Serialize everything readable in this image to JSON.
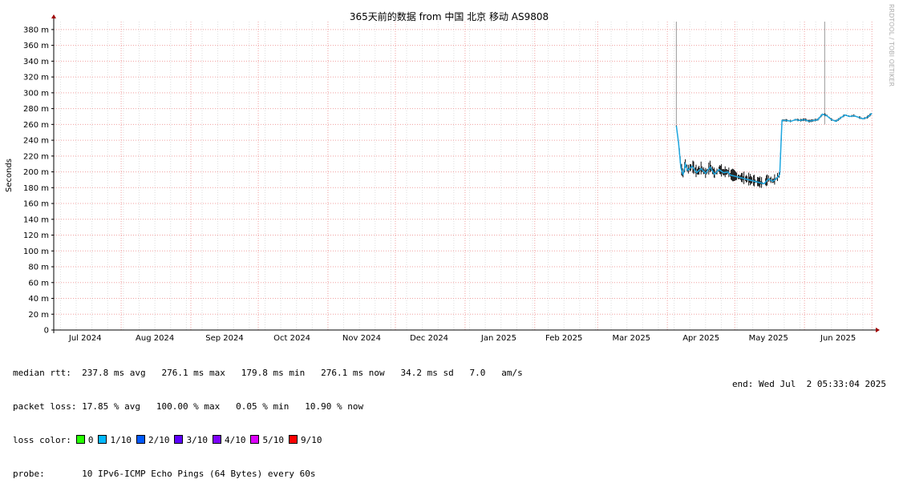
{
  "chart_data": {
    "type": "line",
    "title": "365天前的数据 from 中国 北京 移动 AS9808",
    "ylabel": "Seconds",
    "xlabel": "",
    "ylim": [
      0,
      390
    ],
    "yticks": [
      {
        "v": 0,
        "label": "0"
      },
      {
        "v": 20,
        "label": "20 m"
      },
      {
        "v": 40,
        "label": "40 m"
      },
      {
        "v": 60,
        "label": "60 m"
      },
      {
        "v": 80,
        "label": "80 m"
      },
      {
        "v": 100,
        "label": "100 m"
      },
      {
        "v": 120,
        "label": "120 m"
      },
      {
        "v": 140,
        "label": "140 m"
      },
      {
        "v": 160,
        "label": "160 m"
      },
      {
        "v": 180,
        "label": "180 m"
      },
      {
        "v": 200,
        "label": "200 m"
      },
      {
        "v": 220,
        "label": "220 m"
      },
      {
        "v": 240,
        "label": "240 m"
      },
      {
        "v": 260,
        "label": "260 m"
      },
      {
        "v": 280,
        "label": "280 m"
      },
      {
        "v": 300,
        "label": "300 m"
      },
      {
        "v": 320,
        "label": "320 m"
      },
      {
        "v": 340,
        "label": "340 m"
      },
      {
        "v": 360,
        "label": "360 m"
      },
      {
        "v": 380,
        "label": "380 m"
      }
    ],
    "x_range": [
      "2024-07-02",
      "2025-07-02"
    ],
    "xticks": [
      {
        "label": "Jul 2024",
        "date": "2024-07-16"
      },
      {
        "label": "Aug 2024",
        "date": "2024-08-16"
      },
      {
        "label": "Sep 2024",
        "date": "2024-09-16"
      },
      {
        "label": "Oct 2024",
        "date": "2024-10-16"
      },
      {
        "label": "Nov 2024",
        "date": "2024-11-16"
      },
      {
        "label": "Dec 2024",
        "date": "2024-12-16"
      },
      {
        "label": "Jan 2025",
        "date": "2025-01-16"
      },
      {
        "label": "Feb 2025",
        "date": "2025-02-14"
      },
      {
        "label": "Mar 2025",
        "date": "2025-03-16"
      },
      {
        "label": "Apr 2025",
        "date": "2025-04-16"
      },
      {
        "label": "May 2025",
        "date": "2025-05-16"
      },
      {
        "label": "Jun 2025",
        "date": "2025-06-16"
      }
    ],
    "month_boundaries": [
      "2024-08-01",
      "2024-09-01",
      "2024-10-01",
      "2024-11-01",
      "2024-12-01",
      "2025-01-01",
      "2025-02-01",
      "2025-03-01",
      "2025-04-01",
      "2025-05-01",
      "2025-06-01",
      "2025-07-01"
    ],
    "grid": true,
    "series": [
      {
        "color": "#1ea7e0",
        "x": [
          "2025-04-05",
          "2025-04-06",
          "2025-04-07",
          "2025-04-08",
          "2025-04-09",
          "2025-04-10",
          "2025-04-12",
          "2025-04-14",
          "2025-04-16",
          "2025-04-18",
          "2025-04-20",
          "2025-04-22",
          "2025-04-24",
          "2025-04-26",
          "2025-04-28",
          "2025-04-29",
          "2025-05-14",
          "2025-05-16",
          "2025-05-18",
          "2025-05-20",
          "2025-05-21",
          "2025-05-22",
          "2025-05-24",
          "2025-05-26",
          "2025-05-28",
          "2025-05-30",
          "2025-06-01",
          "2025-06-03",
          "2025-06-05",
          "2025-06-07",
          "2025-06-09",
          "2025-06-11",
          "2025-06-13",
          "2025-06-15",
          "2025-06-17",
          "2025-06-19",
          "2025-06-21",
          "2025-06-23",
          "2025-06-25",
          "2025-06-27",
          "2025-06-29",
          "2025-07-01"
        ],
        "y": [
          258,
          236,
          205,
          196,
          210,
          202,
          207,
          199,
          204,
          198,
          206,
          197,
          203,
          199,
          200,
          196,
          185,
          191,
          188,
          193,
          197,
          265,
          265,
          264,
          266,
          265,
          266,
          264,
          265,
          266,
          273,
          271,
          266,
          264,
          268,
          272,
          270,
          271,
          269,
          267,
          269,
          274
        ]
      }
    ],
    "spikes": [
      {
        "date": "2025-04-05",
        "y": 390
      },
      {
        "date": "2025-06-10",
        "y": 390
      }
    ]
  },
  "legend": {
    "median_label": "median rtt:",
    "median_text": "237.8 ms avg   276.1 ms max   179.8 ms min   276.1 ms now   34.2 ms sd   7.0   am/s",
    "loss_label": "packet loss:",
    "loss_text": "17.85 % avg   100.00 % max   0.05 % min   10.90 % now",
    "color_label": "loss color:",
    "colors": [
      {
        "label": "0",
        "color": "#26ff00"
      },
      {
        "label": "1/10",
        "color": "#00b8ff"
      },
      {
        "label": "2/10",
        "color": "#0059ff"
      },
      {
        "label": "3/10",
        "color": "#5e00ff"
      },
      {
        "label": "4/10",
        "color": "#7e00ff"
      },
      {
        "label": "5/10",
        "color": "#dd00ff"
      },
      {
        "label": "9/10",
        "color": "#ff0000"
      }
    ],
    "probe_label": "probe:",
    "probe_text": "10 IPv6-ICMP Echo Pings (64 Bytes) every 60s",
    "end_text": "end: Wed Jul  2 05:33:04 2025"
  },
  "watermark": "RRDTOOL / TOBI OETIKER"
}
